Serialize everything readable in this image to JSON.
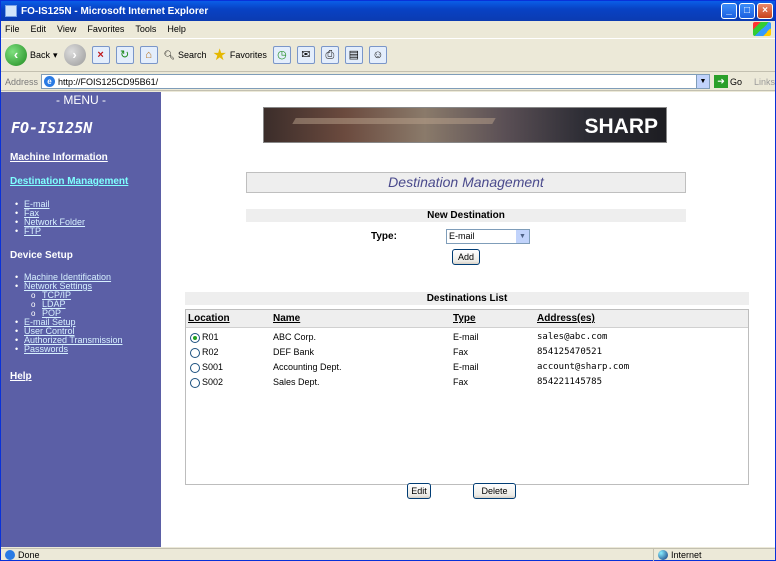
{
  "window": {
    "title": "FO-IS125N - Microsoft Internet Explorer"
  },
  "menubar": {
    "items": [
      "File",
      "Edit",
      "View",
      "Favorites",
      "Tools",
      "Help"
    ]
  },
  "toolbar": {
    "back": "Back",
    "search": "Search",
    "favorites": "Favorites"
  },
  "address": {
    "label": "Address",
    "url": "http://FOIS125CD95B61/",
    "go": "Go",
    "links": "Links"
  },
  "sidebar": {
    "menu_head": "- MENU -",
    "model": "FO-IS125N",
    "machine_information": "Machine Information",
    "destination_management": "Destination Management",
    "dest_items": [
      "E-mail",
      "Fax",
      "Network Folder",
      "FTP"
    ],
    "device_setup": "Device Setup",
    "setup_items": [
      "Machine Identification",
      "Network Settings"
    ],
    "network_sub": [
      "TCP/IP",
      "LDAP",
      "POP"
    ],
    "setup_items2": [
      "E-mail Setup",
      "User Control",
      "Authorized Transmission",
      "Passwords"
    ],
    "help": "Help"
  },
  "banner": {
    "logo": "SHARP"
  },
  "page": {
    "title": "Destination Management",
    "new_destination": "New Destination",
    "type_label": "Type:",
    "type_value": "E-mail",
    "add": "Add",
    "list_title": "Destinations List",
    "columns": [
      "Location",
      "Name",
      "Type",
      "Address(es)"
    ],
    "rows": [
      {
        "location": "R01",
        "name": "ABC Corp.",
        "type": "E-mail",
        "address": "sales@abc.com",
        "selected": true
      },
      {
        "location": "R02",
        "name": "DEF Bank",
        "type": "Fax",
        "address": "854125470521",
        "selected": false
      },
      {
        "location": "S001",
        "name": "Accounting Dept.",
        "type": "E-mail",
        "address": "account@sharp.com",
        "selected": false
      },
      {
        "location": "S002",
        "name": "Sales Dept.",
        "type": "Fax",
        "address": "854221145785",
        "selected": false
      }
    ],
    "edit": "Edit",
    "delete": "Delete"
  },
  "status": {
    "left": "Done",
    "zone": "Internet"
  }
}
